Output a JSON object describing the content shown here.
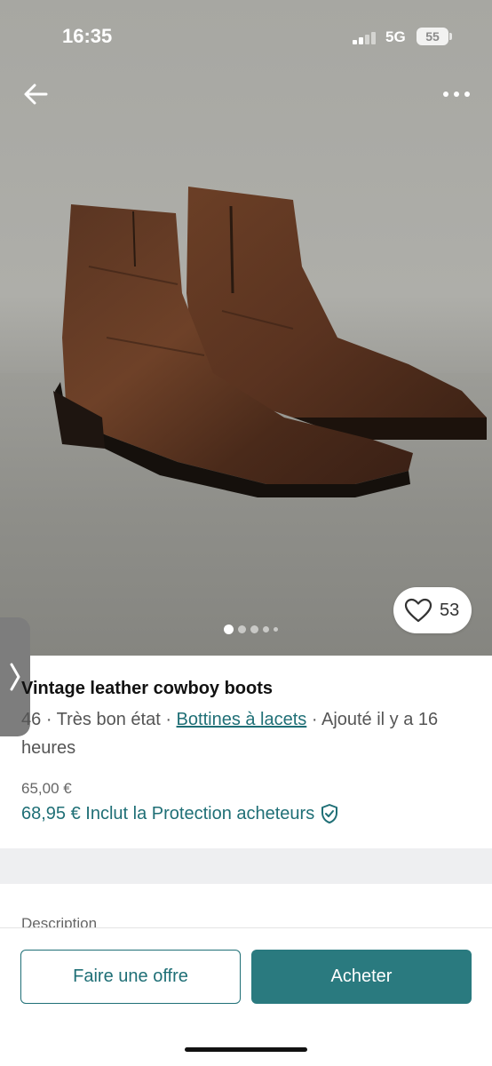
{
  "status_bar": {
    "time": "16:35",
    "network": "5G",
    "battery": "55"
  },
  "photo": {
    "carousel_dots": 5,
    "active_dot": 0
  },
  "favourite": {
    "count": "53"
  },
  "item": {
    "title": "Vintage leather cowboy boots",
    "size": "46",
    "condition": "· Très bon état ·",
    "category": "Bottines à lacets",
    "added": "· Ajouté il y a 16 heures",
    "price": "65,00 €",
    "price_with_protection": "68,95 € Inclut la Protection acheteurs"
  },
  "description_label": "Description",
  "actions": {
    "offer_label": "Faire une offre",
    "buy_label": "Acheter"
  },
  "colors": {
    "accent": "#1f6f76",
    "buy_button": "#2a7a7f"
  }
}
